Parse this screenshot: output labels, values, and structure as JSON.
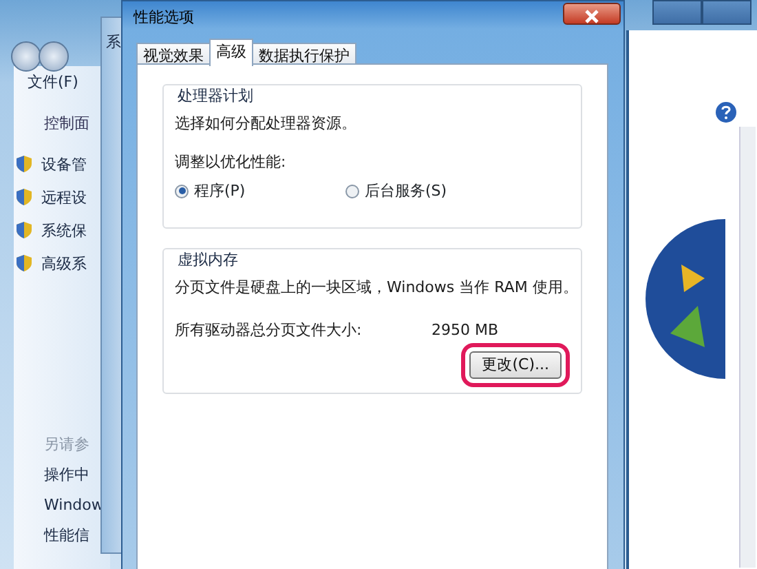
{
  "back_window": {
    "menu": [
      "文件(F)"
    ],
    "crumb": "控制面",
    "tasks": [
      "设备管",
      "远程设",
      "系统保",
      "高级系"
    ],
    "see_also_title": "另请参",
    "see_also": [
      "操作中",
      "Window",
      "性能信"
    ]
  },
  "middle_window": {
    "title": "系"
  },
  "dialog": {
    "title": "性能选项",
    "tabs": [
      {
        "label": "视觉效果",
        "selected": false
      },
      {
        "label": "高级",
        "selected": true
      },
      {
        "label": "数据执行保护",
        "selected": false
      }
    ],
    "processor": {
      "legend": "处理器计划",
      "description": "选择如何分配处理器资源。",
      "prompt": "调整以优化性能:",
      "options": [
        {
          "label": "程序(P)",
          "selected": true
        },
        {
          "label": "后台服务(S)",
          "selected": false
        }
      ]
    },
    "virtual_memory": {
      "legend": "虚拟内存",
      "description": "分页文件是硬盘上的一块区域，Windows 当作 RAM 使用。",
      "size_label": "所有驱动器总分页文件大小:",
      "size_value": "2950 MB",
      "change_button": {
        "label": "更改(C)...",
        "highlighted": true
      }
    }
  }
}
